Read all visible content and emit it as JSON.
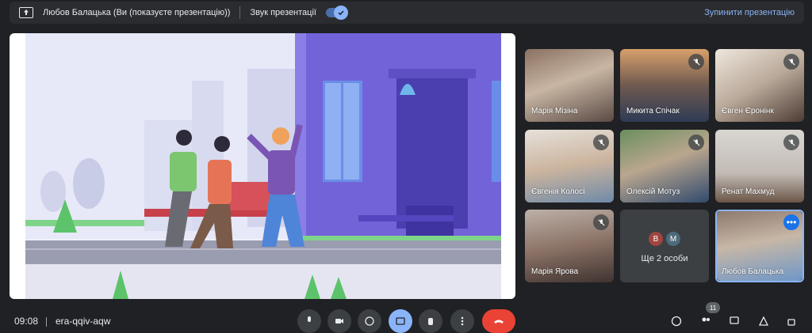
{
  "topbar": {
    "presenter": "Любов Балацька (Ви (показуєте презентацію))",
    "audio_label": "Звук презентації",
    "audio_enabled": true,
    "stop_label": "Зупинити презентацію"
  },
  "participants": [
    {
      "name": "Марія Мізіна",
      "muted": false
    },
    {
      "name": "Микита Спічак",
      "muted": true
    },
    {
      "name": "Євген Єронінк",
      "muted": true
    },
    {
      "name": "Євгенія Колосі",
      "muted": true
    },
    {
      "name": "Олексій Мотуз",
      "muted": true
    },
    {
      "name": "Ренат Махмуд",
      "muted": true
    },
    {
      "name": "Марія Ярова",
      "muted": true
    },
    {
      "name": "Любов Балацька",
      "muted": false
    }
  ],
  "others": {
    "label": "Ще 2 особи",
    "avatars": [
      {
        "letter": "B",
        "color": "#a0453f"
      },
      {
        "letter": "M",
        "color": "#4d6b7a"
      }
    ]
  },
  "bottombar": {
    "time": "09:08",
    "meeting_code": "era-qqiv-aqw",
    "participant_count": "11"
  },
  "colors": {
    "accent": "#8ab4f8",
    "end_call": "#ea4335",
    "tile_bg": "#3c4043"
  }
}
